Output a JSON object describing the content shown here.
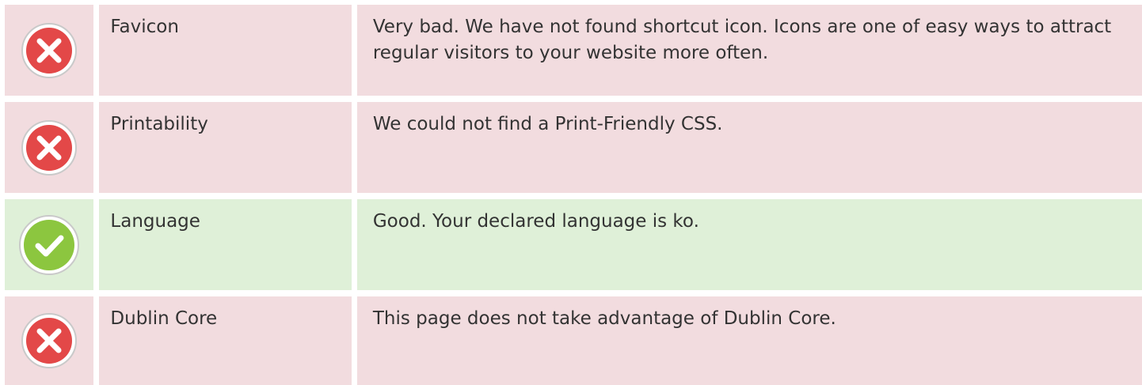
{
  "rows": [
    {
      "status": "error",
      "icon": "x-circle-icon",
      "name": "Favicon",
      "description": "Very bad. We have not found shortcut icon. Icons are one of easy ways to attract regular visitors to your website more often."
    },
    {
      "status": "error",
      "icon": "x-circle-icon",
      "name": "Printability",
      "description": "We could not find a Print-Friendly CSS."
    },
    {
      "status": "success",
      "icon": "check-circle-icon",
      "name": "Language",
      "description": "Good. Your declared language is ko."
    },
    {
      "status": "error",
      "icon": "x-circle-icon",
      "name": "Dublin Core",
      "description": "This page does not take advantage of Dublin Core."
    }
  ],
  "colors": {
    "error_bg": "#f2dcdf",
    "success_bg": "#dff0d8",
    "error_icon": "#e34848",
    "success_icon": "#8cc63f"
  }
}
